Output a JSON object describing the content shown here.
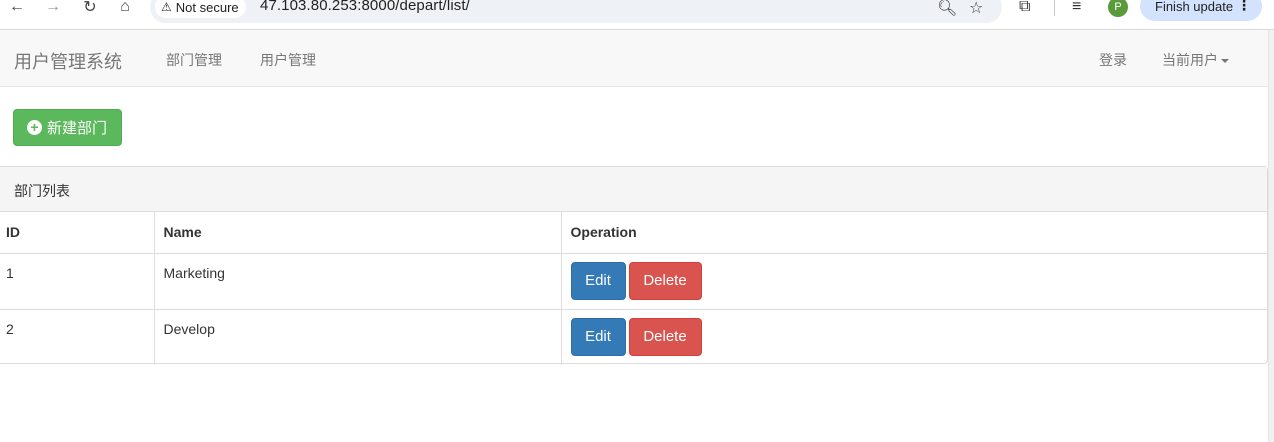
{
  "browser": {
    "security_label": "Not secure",
    "url": "47.103.80.253:8000/depart/list/",
    "profile_initial": "P",
    "update_label": "Finish update"
  },
  "navbar": {
    "brand": "用户管理系统",
    "links": [
      "部门管理",
      "用户管理"
    ],
    "login": "登录",
    "current_user": "当前用户"
  },
  "actions": {
    "new_department": "新建部门"
  },
  "panel": {
    "title": "部门列表",
    "columns": [
      "ID",
      "Name",
      "Operation"
    ],
    "rows": [
      {
        "id": "1",
        "name": "Marketing",
        "edit": "Edit",
        "delete": "Delete"
      },
      {
        "id": "2",
        "name": "Develop",
        "edit": "Edit",
        "delete": "Delete"
      }
    ]
  },
  "colors": {
    "success": "#5cb85c",
    "primary": "#337ab7",
    "danger": "#d9534f"
  }
}
